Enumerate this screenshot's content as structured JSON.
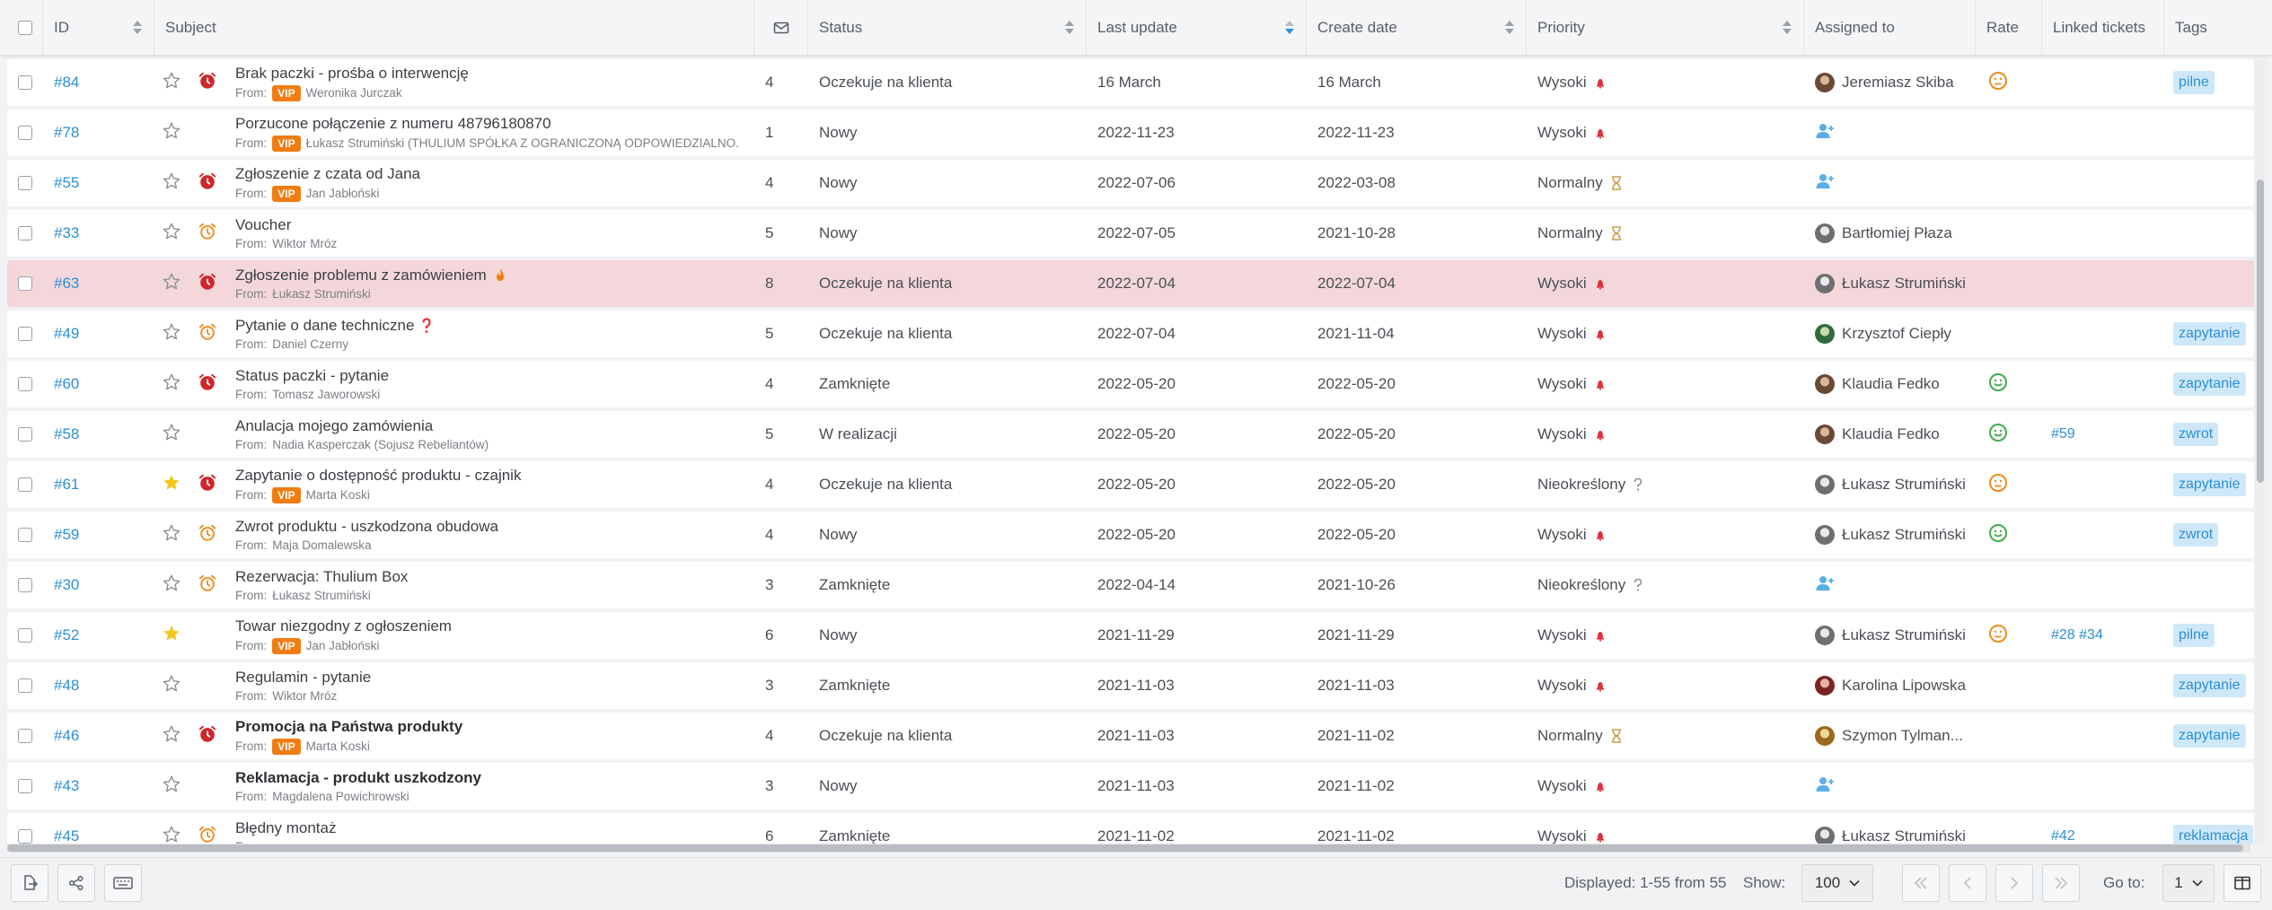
{
  "columns": {
    "id": "ID",
    "subject": "Subject",
    "status": "Status",
    "last_update": "Last update",
    "create_date": "Create date",
    "priority": "Priority",
    "assigned_to": "Assigned to",
    "rate": "Rate",
    "linked": "Linked tickets",
    "tags": "Tags"
  },
  "from_prefix": "From:",
  "vip_label": "VIP",
  "colors": {
    "link": "#2d8fd5",
    "vip": "#f07d12",
    "tag_bg": "#cfe8f9",
    "highlight_row": "#f4d7da",
    "alarm_red": "#d0262b",
    "alarm_orange": "#f08a1c",
    "star_yellow": "#f5c518",
    "rate_green": "#3fae49",
    "rate_orange": "#f08a1c"
  },
  "rows": [
    {
      "id": "#84",
      "starred": false,
      "alarm": "red",
      "subject": "Brak paczki - prośba o interwencję",
      "bold": false,
      "vip": true,
      "from": "Weronika Jurczak",
      "count": "4",
      "status": "Oczekuje na klienta",
      "last_update": "16 March",
      "create_date": "16 March",
      "priority": "Wysoki",
      "priority_icon": "high",
      "assigned": "Jeremiasz Skiba",
      "avatar": "brown",
      "rate": "neutral",
      "linked": "",
      "tag": "pilne"
    },
    {
      "id": "#78",
      "starred": false,
      "alarm": "",
      "subject": "Porzucone połączenie z numeru 48796180870",
      "bold": false,
      "vip": true,
      "from": "Łukasz Strumiński (THULIUM SPÓŁKA Z OGRANICZONĄ ODPOWIEDZIALNO...",
      "count": "1",
      "status": "Nowy",
      "last_update": "2022-11-23",
      "create_date": "2022-11-23",
      "priority": "Wysoki",
      "priority_icon": "high",
      "assigned": "",
      "avatar": "",
      "rate": "",
      "linked": "",
      "tag": ""
    },
    {
      "id": "#55",
      "starred": false,
      "alarm": "red",
      "subject": "Zgłoszenie z czata od Jana",
      "bold": false,
      "vip": true,
      "from": "Jan Jabłoński",
      "count": "4",
      "status": "Nowy",
      "last_update": "2022-07-06",
      "create_date": "2022-03-08",
      "priority": "Normalny",
      "priority_icon": "normal",
      "assigned": "",
      "avatar": "",
      "rate": "",
      "linked": "",
      "tag": ""
    },
    {
      "id": "#33",
      "starred": false,
      "alarm": "orange",
      "subject": "Voucher",
      "bold": false,
      "vip": false,
      "from": "Wiktor Mróz",
      "count": "5",
      "status": "Nowy",
      "last_update": "2022-07-05",
      "create_date": "2021-10-28",
      "priority": "Normalny",
      "priority_icon": "normal",
      "assigned": "Bartłomiej Płaza",
      "avatar": "grey",
      "rate": "",
      "linked": "",
      "tag": ""
    },
    {
      "id": "#63",
      "starred": false,
      "alarm": "red",
      "subject": "Zgłoszenie problemu z zamówieniem",
      "bold": false,
      "vip": false,
      "from": "Łukasz Strumiński",
      "count": "8",
      "status": "Oczekuje na klienta",
      "last_update": "2022-07-04",
      "create_date": "2022-07-04",
      "priority": "Wysoki",
      "priority_icon": "high",
      "assigned": "Łukasz Strumiński",
      "avatar": "grey",
      "rate": "",
      "linked": "",
      "tag": "",
      "highlight": true,
      "subject_icon": "fire"
    },
    {
      "id": "#49",
      "starred": false,
      "alarm": "orange",
      "subject": "Pytanie o dane techniczne",
      "bold": false,
      "vip": false,
      "from": "Daniel Czerny",
      "count": "5",
      "status": "Oczekuje na klienta",
      "last_update": "2022-07-04",
      "create_date": "2021-11-04",
      "priority": "Wysoki",
      "priority_icon": "high",
      "assigned": "Krzysztof Ciepły",
      "avatar": "green",
      "rate": "",
      "linked": "",
      "tag": "zapytanie",
      "subject_icon": "question"
    },
    {
      "id": "#60",
      "starred": false,
      "alarm": "red",
      "subject": "Status paczki - pytanie",
      "bold": false,
      "vip": false,
      "from": "Tomasz Jaworowski",
      "count": "4",
      "status": "Zamknięte",
      "last_update": "2022-05-20",
      "create_date": "2022-05-20",
      "priority": "Wysoki",
      "priority_icon": "high",
      "assigned": "Klaudia Fedko",
      "avatar": "brown",
      "rate": "happy",
      "linked": "",
      "tag": "zapytanie"
    },
    {
      "id": "#58",
      "starred": false,
      "alarm": "",
      "subject": "Anulacja mojego zamówienia",
      "bold": false,
      "vip": false,
      "from": "Nadia Kasperczak (Sojusz Rebeliantów)",
      "count": "5",
      "status": "W realizacji",
      "last_update": "2022-05-20",
      "create_date": "2022-05-20",
      "priority": "Wysoki",
      "priority_icon": "high",
      "assigned": "Klaudia Fedko",
      "avatar": "brown",
      "rate": "happy",
      "linked": "#59",
      "tag": "zwrot"
    },
    {
      "id": "#61",
      "starred": true,
      "alarm": "red",
      "subject": "Zapytanie o dostępność produktu - czajnik",
      "bold": false,
      "vip": true,
      "from": "Marta Koski",
      "count": "4",
      "status": "Oczekuje na klienta",
      "last_update": "2022-05-20",
      "create_date": "2022-05-20",
      "priority": "Nieokreślony",
      "priority_icon": "unknown",
      "assigned": "Łukasz Strumiński",
      "avatar": "grey",
      "rate": "neutral",
      "linked": "",
      "tag": "zapytanie"
    },
    {
      "id": "#59",
      "starred": false,
      "alarm": "orange",
      "subject": "Zwrot produktu - uszkodzona obudowa",
      "bold": false,
      "vip": false,
      "from": "Maja Domalewska",
      "count": "4",
      "status": "Nowy",
      "last_update": "2022-05-20",
      "create_date": "2022-05-20",
      "priority": "Wysoki",
      "priority_icon": "high",
      "assigned": "Łukasz Strumiński",
      "avatar": "grey",
      "rate": "happy",
      "linked": "",
      "tag": "zwrot"
    },
    {
      "id": "#30",
      "starred": false,
      "alarm": "orange",
      "subject": "Rezerwacja: Thulium Box",
      "bold": false,
      "vip": false,
      "from": "Łukasz Strumiński",
      "count": "3",
      "status": "Zamknięte",
      "last_update": "2022-04-14",
      "create_date": "2021-10-26",
      "priority": "Nieokreślony",
      "priority_icon": "unknown",
      "assigned": "",
      "avatar": "",
      "rate": "",
      "linked": "",
      "tag": ""
    },
    {
      "id": "#52",
      "starred": true,
      "alarm": "",
      "subject": "Towar niezgodny z ogłoszeniem",
      "bold": false,
      "vip": true,
      "from": "Jan Jabłoński",
      "count": "6",
      "status": "Nowy",
      "last_update": "2021-11-29",
      "create_date": "2021-11-29",
      "priority": "Wysoki",
      "priority_icon": "high",
      "assigned": "Łukasz Strumiński",
      "avatar": "grey",
      "rate": "neutral",
      "linked": "#28 #34",
      "tag": "pilne"
    },
    {
      "id": "#48",
      "starred": false,
      "alarm": "",
      "subject": "Regulamin - pytanie",
      "bold": false,
      "vip": false,
      "from": "Wiktor Mróz",
      "count": "3",
      "status": "Zamknięte",
      "last_update": "2021-11-03",
      "create_date": "2021-11-03",
      "priority": "Wysoki",
      "priority_icon": "high",
      "assigned": "Karolina Lipowska",
      "avatar": "red",
      "rate": "",
      "linked": "",
      "tag": "zapytanie"
    },
    {
      "id": "#46",
      "starred": false,
      "alarm": "red",
      "subject": "Promocja na Państwa produkty",
      "bold": true,
      "vip": true,
      "from": "Marta Koski",
      "count": "4",
      "status": "Oczekuje na klienta",
      "last_update": "2021-11-03",
      "create_date": "2021-11-02",
      "priority": "Normalny",
      "priority_icon": "normal",
      "assigned": "Szymon Tylman...",
      "avatar": "yellow",
      "rate": "",
      "linked": "",
      "tag": "zapytanie"
    },
    {
      "id": "#43",
      "starred": false,
      "alarm": "",
      "subject": "Reklamacja - produkt uszkodzony",
      "bold": true,
      "vip": false,
      "from": "Magdalena Powichrowski",
      "count": "3",
      "status": "Nowy",
      "last_update": "2021-11-03",
      "create_date": "2021-11-02",
      "priority": "Wysoki",
      "priority_icon": "high",
      "assigned": "",
      "avatar": "",
      "rate": "",
      "linked": "",
      "tag": ""
    },
    {
      "id": "#45",
      "starred": false,
      "alarm": "orange",
      "subject": "Błędny montaż",
      "bold": false,
      "vip": false,
      "from": "",
      "count": "6",
      "status": "Zamknięte",
      "last_update": "2021-11-02",
      "create_date": "2021-11-02",
      "priority": "Wysoki",
      "priority_icon": "high",
      "assigned": "Łukasz Strumiński",
      "avatar": "grey",
      "rate": "",
      "linked": "#42",
      "tag": "reklamacja"
    }
  ],
  "footer": {
    "displayed": "Displayed: 1-55 from 55",
    "show_label": "Show:",
    "show_value": "100",
    "goto_label": "Go to:",
    "goto_value": "1"
  }
}
